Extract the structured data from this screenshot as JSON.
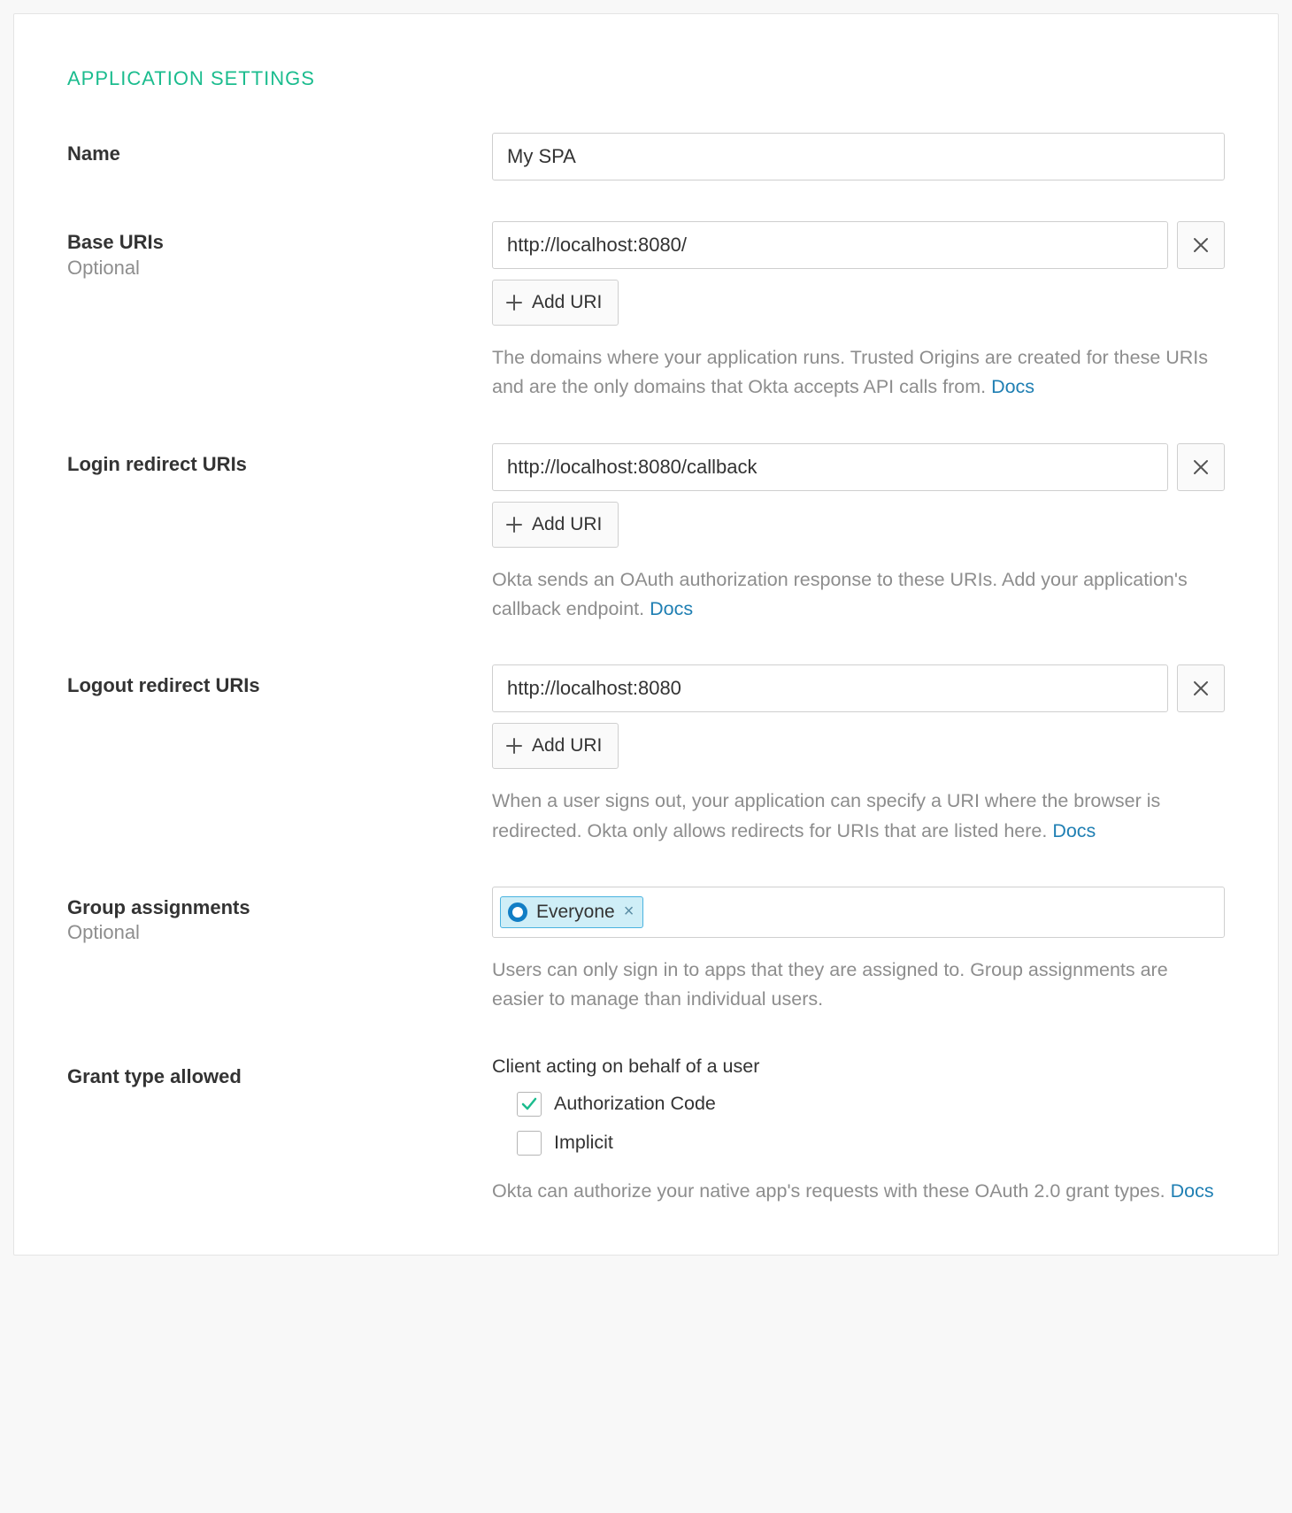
{
  "section_title": "APPLICATION SETTINGS",
  "name": {
    "label": "Name",
    "value": "My SPA"
  },
  "base_uris": {
    "label": "Base URIs",
    "optional": "Optional",
    "value": "http://localhost:8080/",
    "add_label": "Add URI",
    "help_pre": "The domains where your application runs. Trusted Origins are created for these URIs and are the only domains that Okta accepts API calls from. ",
    "docs": "Docs"
  },
  "login_uris": {
    "label": "Login redirect URIs",
    "value": "http://localhost:8080/callback",
    "add_label": "Add URI",
    "help_pre": "Okta sends an OAuth authorization response to these URIs. Add your application's callback endpoint. ",
    "docs": "Docs"
  },
  "logout_uris": {
    "label": "Logout redirect URIs",
    "value": "http://localhost:8080",
    "add_label": "Add URI",
    "help_pre": "When a user signs out, your application can specify a URI where the browser is redirected. Okta only allows redirects for URIs that are listed here. ",
    "docs": "Docs"
  },
  "groups": {
    "label": "Group assignments",
    "optional": "Optional",
    "token": "Everyone",
    "help": "Users can only sign in to apps that they are assigned to. Group assignments are easier to manage than individual users."
  },
  "grant": {
    "label": "Grant type allowed",
    "subheading": "Client acting on behalf of a user",
    "opt1": "Authorization Code",
    "opt2": "Implicit",
    "help_pre": "Okta can authorize your native app's requests with these OAuth 2.0 grant types. ",
    "docs": "Docs"
  }
}
